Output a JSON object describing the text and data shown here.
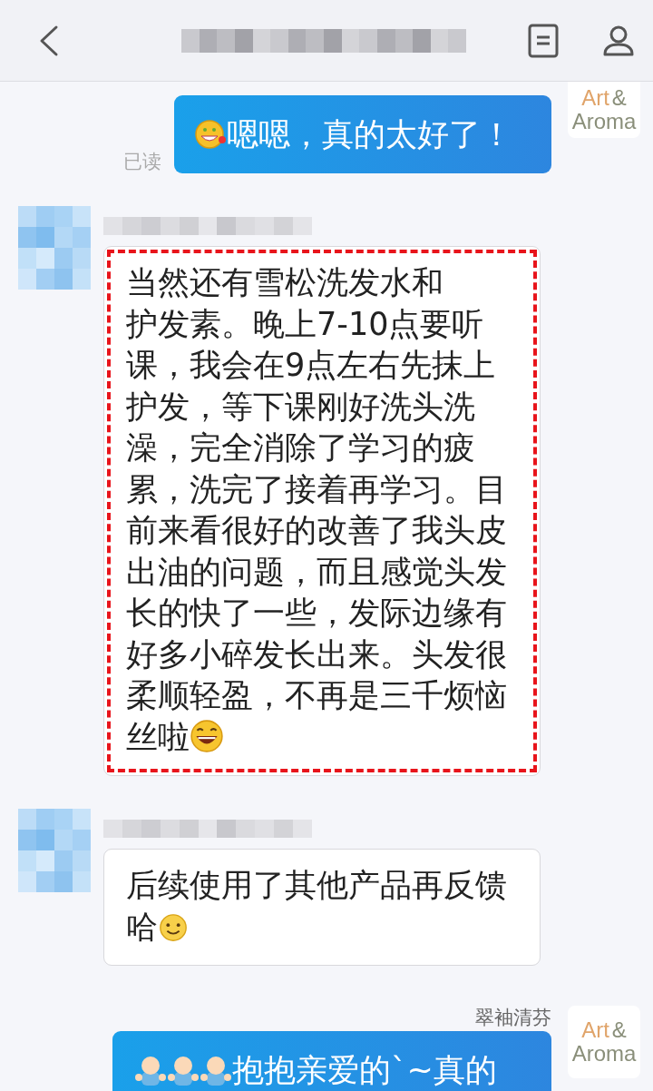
{
  "messages": [
    {
      "kind": "outgoing",
      "logo": {
        "line1": "Art",
        "amp": "&",
        "line2": "Aroma"
      },
      "status": "已读",
      "parts": [
        {
          "kind": "emoji-face"
        },
        {
          "kind": "text",
          "text": "嗯嗯，真的太好了！"
        }
      ]
    },
    {
      "kind": "incoming",
      "highlighted": true,
      "parts": [
        {
          "kind": "text",
          "text": "当然还有雪松洗发水和"
        },
        {
          "kind": "break"
        },
        {
          "kind": "text",
          "text": "护发素。晚上7-10点要听课，我会在9点左右先抹上护发，等下课刚好洗头洗澡，完全消除了学习的疲累，洗完了接着再学习。目前来看很好的改善了我头皮出油的问题，而且感觉头发长的快了一些，发际边缘有好多小碎发长出来。头发很柔顺轻盈，不再是三千烦恼丝啦"
        },
        {
          "kind": "emoji-laugh"
        }
      ]
    },
    {
      "kind": "incoming",
      "highlighted": false,
      "parts": [
        {
          "kind": "text",
          "text": "后续使用了其他产品再反馈哈"
        },
        {
          "kind": "emoji-smile"
        }
      ]
    },
    {
      "kind": "outgoing",
      "sender": "翠袖清芬",
      "logo": {
        "line1": "Art",
        "amp": "&",
        "line2": "Aroma"
      },
      "parts": [
        {
          "kind": "emoji-baby"
        },
        {
          "kind": "emoji-baby"
        },
        {
          "kind": "emoji-baby"
        },
        {
          "kind": "text",
          "text": "抱抱亲爱的`~真的"
        }
      ]
    }
  ]
}
